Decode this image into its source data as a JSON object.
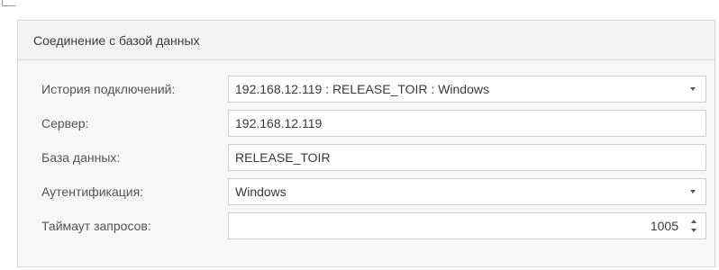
{
  "group": {
    "title": "Соединение с базой данных"
  },
  "form": {
    "history": {
      "label": "История подключений:",
      "value": "192.168.12.119 : RELEASE_TOIR : Windows"
    },
    "server": {
      "label": "Сервер:",
      "value": "192.168.12.119"
    },
    "database": {
      "label": "База данных:",
      "value": "RELEASE_TOIR"
    },
    "auth": {
      "label": "Аутентификация:",
      "value": "Windows"
    },
    "timeout": {
      "label": "Таймаут запросов:",
      "value": "1005"
    }
  }
}
